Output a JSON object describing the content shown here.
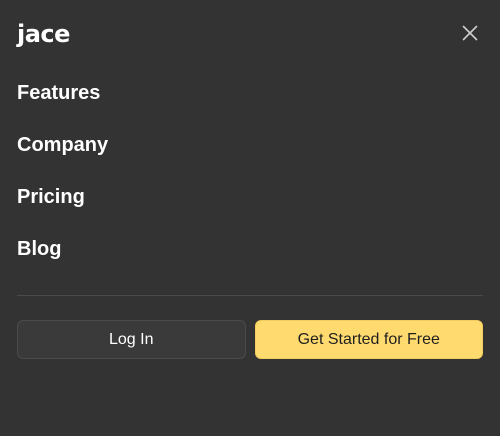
{
  "header": {
    "logo_text": "jace",
    "close_icon": "close-icon"
  },
  "nav": {
    "items": [
      {
        "label": "Features"
      },
      {
        "label": "Company"
      },
      {
        "label": "Pricing"
      },
      {
        "label": "Blog"
      }
    ]
  },
  "actions": {
    "login_label": "Log In",
    "cta_label": "Get Started for Free"
  },
  "colors": {
    "background": "#333333",
    "cta_background": "#ffda6e",
    "login_background": "#3a3a3a",
    "divider": "#4a4a4a",
    "text": "#ffffff"
  }
}
